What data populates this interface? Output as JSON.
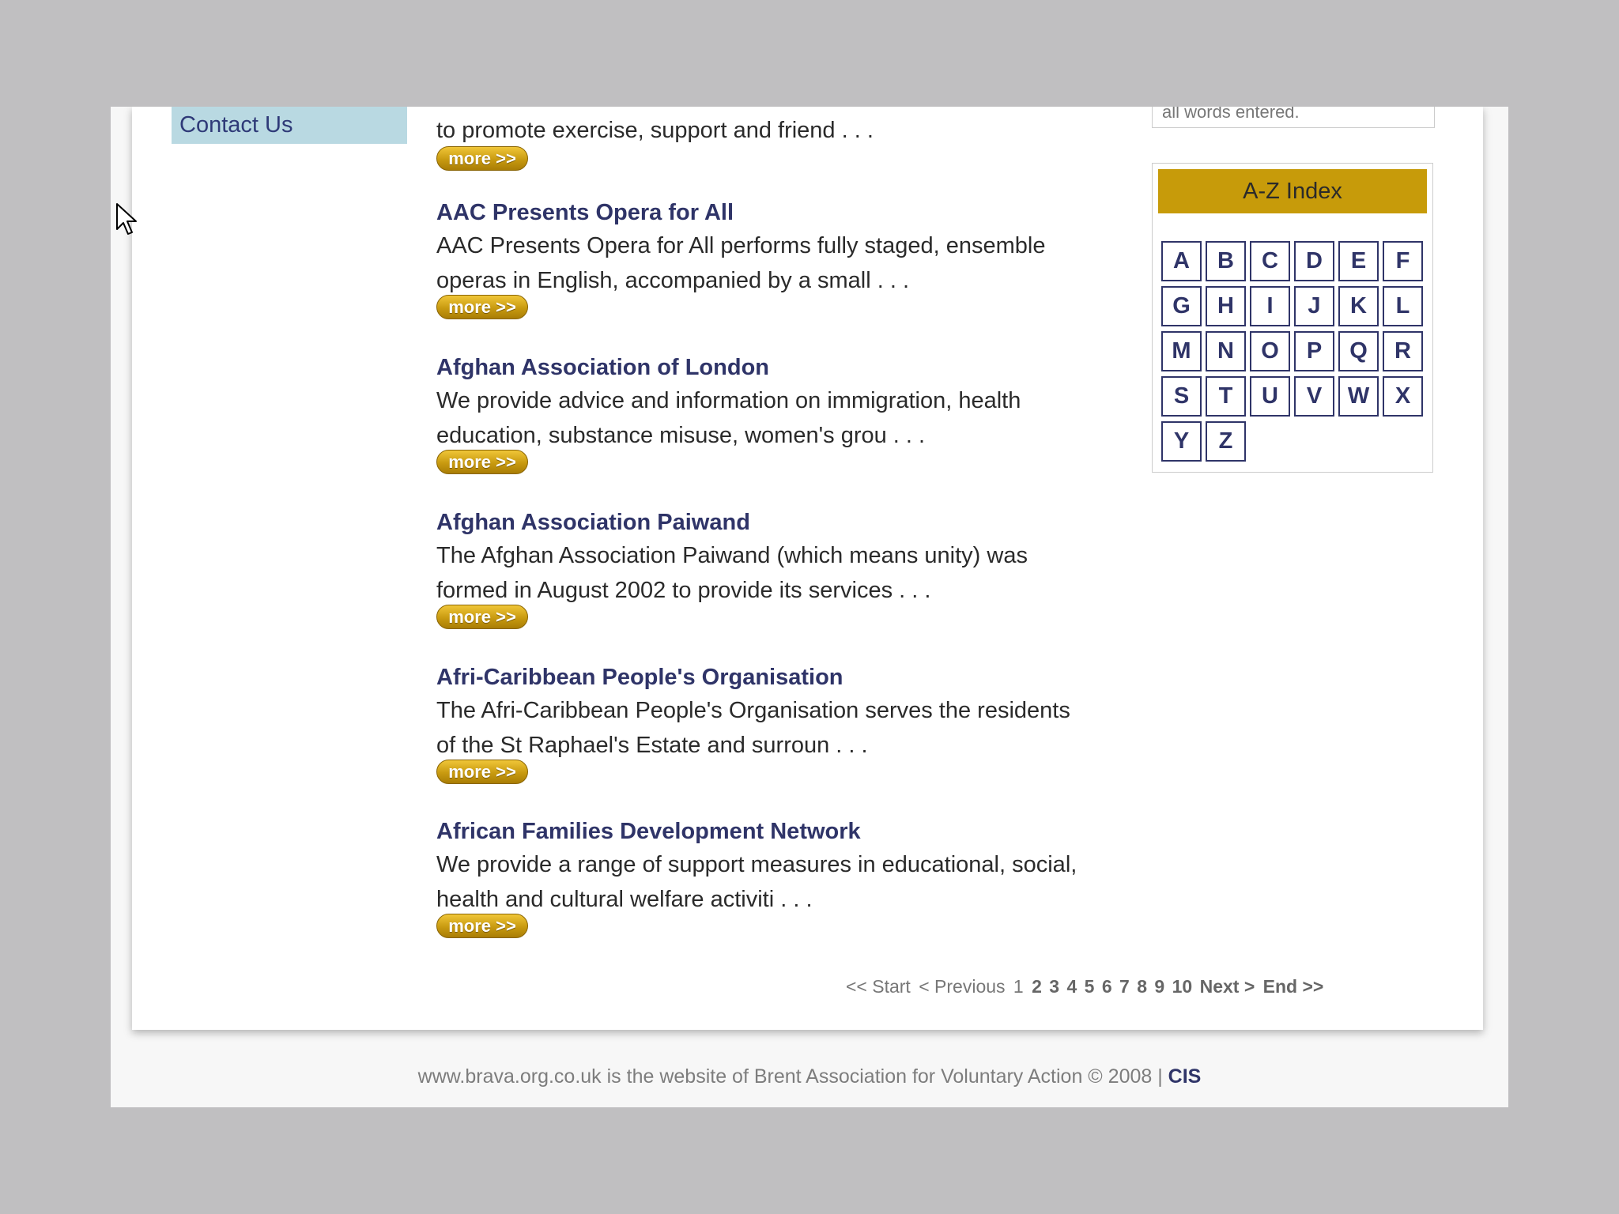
{
  "sidebar": {
    "contact_label": "Contact Us"
  },
  "listing": {
    "intro_desc": "to promote exercise, support and friend . . .",
    "more_label": "more >>",
    "entries": [
      {
        "title": "AAC Presents Opera for All",
        "desc": "AAC Presents Opera for All performs fully staged, ensemble operas in English, accompanied by a small . . ."
      },
      {
        "title": "Afghan Association of London",
        "desc": "We provide advice and information on immigration, health education, substance misuse, women's grou . . ."
      },
      {
        "title": "Afghan Association Paiwand",
        "desc": "The Afghan Association Paiwand (which means unity) was formed in August 2002 to provide its services . . ."
      },
      {
        "title": "Afri-Caribbean People's Organisation",
        "desc": "The Afri-Caribbean People's Organisation serves the residents of the St Raphael's Estate and surroun . . ."
      },
      {
        "title": "African Families Development Network",
        "desc": "We provide a range of support measures in educational, social, health and cultural welfare activiti . . ."
      }
    ]
  },
  "pagination": {
    "start": "<< Start",
    "previous": "< Previous",
    "current": "1",
    "pages": [
      "2",
      "3",
      "4",
      "5",
      "6",
      "7",
      "8",
      "9",
      "10"
    ],
    "next": "Next >",
    "end": "End >>"
  },
  "search": {
    "hint": "all words entered."
  },
  "az_index": {
    "title": "A-Z Index",
    "letters": [
      "A",
      "B",
      "C",
      "D",
      "E",
      "F",
      "G",
      "H",
      "I",
      "J",
      "K",
      "L",
      "M",
      "N",
      "O",
      "P",
      "Q",
      "R",
      "S",
      "T",
      "U",
      "V",
      "W",
      "X",
      "Y",
      "Z"
    ]
  },
  "footer": {
    "text": "www.brava.org.co.uk is the website of Brent Association for Voluntary Action © 2008 |",
    "link": "CIS"
  },
  "colors": {
    "accent_gold": "#c79b0a",
    "title_navy": "#2f3468",
    "sidebar_blue": "#b9d9e2"
  }
}
